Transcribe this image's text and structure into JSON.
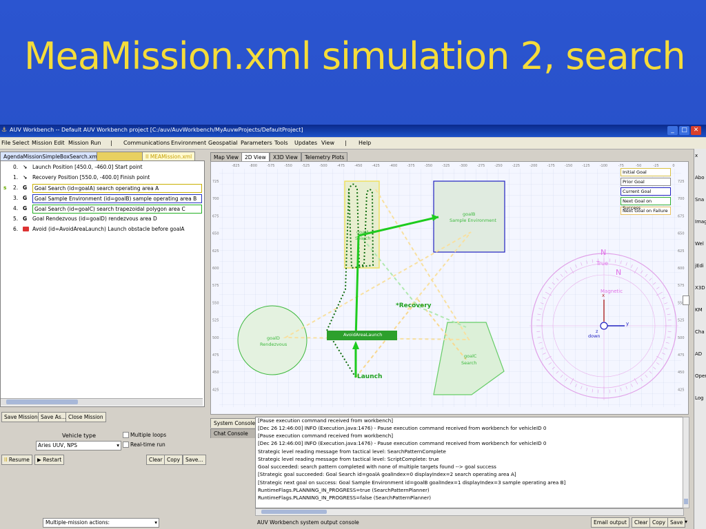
{
  "slide": {
    "title": "MeaMission.xml simulation 2, search"
  },
  "window": {
    "title": "AUV Workbench -- Default AUV Workbench project [C:/auv/AuvWorkbench/MyAuvwProjects/DefaultProject]"
  },
  "menu": {
    "file_select": "File Select",
    "mission_edit": "Mission Edit",
    "mission_run": "Mission Run",
    "sep1": "|",
    "communications": "Communications",
    "environment": "Environment",
    "geospatial": "Geospatial",
    "parameters": "Parameters",
    "tools": "Tools",
    "updates": "Updates",
    "view": "View",
    "sep2": "|",
    "help": "Help"
  },
  "left_tabs": [
    "AgendaMissionSimpleBoxSearch.xml",
    "MEAMission.xml"
  ],
  "left_tab_pause": "II",
  "goals": [
    {
      "num": "0.",
      "icon": "↘",
      "text": "Launch Position [450.0, -460.0] Start point",
      "state": ""
    },
    {
      "num": "1.",
      "icon": "↘",
      "text": "Recovery Position [550.0, -400.0] Finish point",
      "state": ""
    },
    {
      "num": "2.",
      "icon": "G",
      "text": "Goal Search (id=goalA) search operating area A",
      "state": "s"
    },
    {
      "num": "3.",
      "icon": "G",
      "text": "Goal Sample Environment (id=goalB) sample operating area B",
      "state": ""
    },
    {
      "num": "4.",
      "icon": "G",
      "text": "Goal Search (id=goalC) search trapezoidal polygon area C",
      "state": ""
    },
    {
      "num": "5.",
      "icon": "G",
      "text": "Goal Rendezvous (id=goalD) rendezvous area D",
      "state": ""
    },
    {
      "num": "6.",
      "icon": "",
      "text": "Avoid (id=AvoidAreaLaunch) Launch obstacle before goalA",
      "state": ""
    }
  ],
  "left_buttons": {
    "save_mission": "Save Mission",
    "save_as": "Save As...",
    "close_mission": "Close Mission"
  },
  "vehicle": {
    "label": "Vehicle type",
    "value": "Aries UUV, NPS",
    "multiple_loops": "Multiple loops",
    "realtime": "Real-time run"
  },
  "run_buttons": {
    "resume": "Resume",
    "restart": "Restart",
    "clear": "Clear",
    "copy": "Copy",
    "save": "Save..."
  },
  "bottom_left": {
    "multi_actions": "Multiple-mission actions:"
  },
  "map_tabs": [
    "Map View",
    "2D View",
    "X3D View",
    "Telemetry Plots"
  ],
  "map": {
    "top_ticks": [
      "-825",
      "-800",
      "-575",
      "-550",
      "-525",
      "-500",
      "-475",
      "-450",
      "-425",
      "-400",
      "-375",
      "-350",
      "-325",
      "-300",
      "-275",
      "-250",
      "-225",
      "-200",
      "-175",
      "-150",
      "-125",
      "-100",
      "-75",
      "-50",
      "-25",
      "0"
    ],
    "side_ticks": [
      "725",
      "700",
      "675",
      "650",
      "625",
      "600",
      "575",
      "550",
      "525",
      "500",
      "475",
      "450",
      "425"
    ],
    "legend": [
      "Initial Goal",
      "Prior Goal",
      "Current Goal",
      "Next Goal on Success",
      "Next Goal on Failure"
    ],
    "labels": {
      "goalB": "goalB",
      "goalB_sub": "Sample Environment",
      "goalA": "goalA",
      "goalA_sub": "Search",
      "goalD": "goalD",
      "goalD_sub": "Rendezvous",
      "goalC": "goalC",
      "goalC_sub": "Search",
      "avoid": "AvoidAreaLaunch",
      "recovery": "*Recovery",
      "launch": "Launch",
      "compass_n1": "N",
      "compass_true": "True",
      "compass_n2": "N",
      "compass_mag": "Magnetic",
      "axis_x": "x",
      "axis_y": "y",
      "axis_z": "z",
      "axis_down": "down"
    }
  },
  "console": {
    "tabs": [
      "System Console",
      "Chat Console"
    ],
    "lines": [
      "[Pause execution command received from workbench]",
      "[Dec 26 12:46:00] INFO  (Execution.java:1476) - Pause execution command received from workbench for vehicleID 0",
      "[Pause execution command received from workbench]",
      "[Dec 26 12:46:00] INFO  (Execution.java:1476) - Pause execution command received from workbench for vehicleID 0",
      "Strategic level reading message from tactical level: SearchPatternComplete",
      "Strategic level reading message from tactical level: ScriptComplete: true",
      "Goal succeeded: search pattern completed with none of multiple targets found --> goal success",
      "[Strategic goal succeeded: Goal Search id=goalA goalIndex=0 displayIndex=2 search operating area A]",
      "[Strategic next goal on success: Goal Sample Environment id=goalB goalIndex=1 displayIndex=3 sample operating area B]",
      "RuntimeFlags.PLANNING_IN_PROGRESS=true (SearchPatternPlanner)",
      "RuntimeFlags.PLANNING_IN_PROGRESS=false (SearchPatternPlanner)"
    ],
    "footer": "AUV Workbench system output console",
    "email": "Email output",
    "clear": "Clear",
    "copy": "Copy",
    "save": "Save"
  },
  "right_strip": [
    "x",
    "Abo",
    "Sna",
    "Imag",
    "Wel",
    "jEdi",
    "X3D",
    "KM",
    "Cha",
    "AD",
    "Oper",
    "Log"
  ]
}
